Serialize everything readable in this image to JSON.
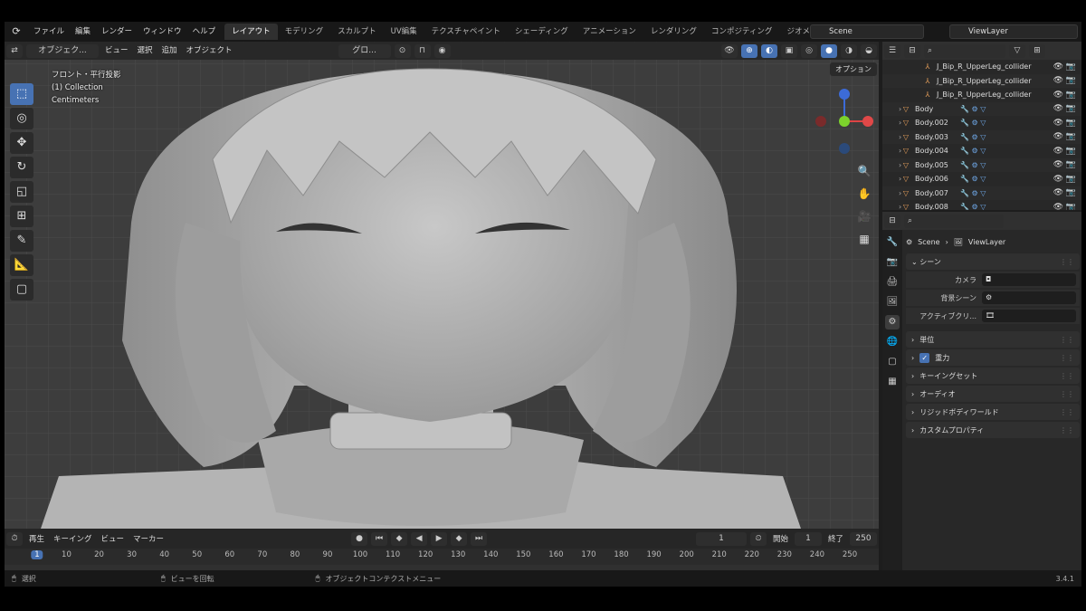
{
  "topbar": {
    "menus": [
      "ファイル",
      "編集",
      "レンダー",
      "ウィンドウ",
      "ヘルプ"
    ],
    "workspace_tabs": [
      "レイアウト",
      "モデリング",
      "スカルプト",
      "UV編集",
      "テクスチャペイント",
      "シェーディング",
      "アニメーション",
      "レンダリング",
      "コンポジティング",
      "ジオメトリ"
    ],
    "active_tab": "レイアウト",
    "scene": "Scene",
    "view_layer": "ViewLayer"
  },
  "viewport": {
    "mode": "オブジェク...",
    "menu": [
      "ビュー",
      "選択",
      "追加",
      "オブジェクト"
    ],
    "transform": "グロ...",
    "options": "オプション",
    "info_lines": [
      "フロント・平行投影",
      "(1) Collection",
      "Centimeters"
    ]
  },
  "timeline": {
    "menu": [
      "再生",
      "キーイング",
      "ビュー",
      "マーカー"
    ],
    "current_frame": "1",
    "start_label": "開始",
    "start": "1",
    "end_label": "終了",
    "end": "250",
    "ruler": [
      "1",
      "10",
      "20",
      "30",
      "40",
      "50",
      "60",
      "70",
      "80",
      "90",
      "100",
      "110",
      "120",
      "130",
      "140",
      "150",
      "160",
      "170",
      "180",
      "190",
      "200",
      "210",
      "220",
      "230",
      "240",
      "250"
    ]
  },
  "status": {
    "select": "選択",
    "rotate": "ビューを回転",
    "context": "オブジェクトコンテクストメニュー",
    "version": "3.4.1"
  },
  "outliner": {
    "rows": [
      {
        "label": "J_Bip_R_UpperLeg_collider",
        "type": "bone"
      },
      {
        "label": "J_Bip_R_UpperLeg_collider",
        "type": "bone"
      },
      {
        "label": "J_Bip_R_UpperLeg_collider",
        "type": "bone"
      },
      {
        "label": "Body",
        "type": "mesh"
      },
      {
        "label": "Body.002",
        "type": "mesh"
      },
      {
        "label": "Body.003",
        "type": "mesh"
      },
      {
        "label": "Body.004",
        "type": "mesh"
      },
      {
        "label": "Body.005",
        "type": "mesh"
      },
      {
        "label": "Body.006",
        "type": "mesh"
      },
      {
        "label": "Body.007",
        "type": "mesh"
      },
      {
        "label": "Body.008",
        "type": "mesh"
      }
    ]
  },
  "properties": {
    "breadcrumb_scene": "Scene",
    "breadcrumb_layer": "ViewLayer",
    "section_scene": "シーン",
    "camera_label": "カメラ",
    "bg_scene_label": "背景シーン",
    "active_clip_label": "アクティブクリ...",
    "sections": [
      "単位",
      "重力",
      "キーイングセット",
      "オーディオ",
      "リジッドボディワールド",
      "カスタムプロパティ"
    ],
    "gravity_checked": true
  }
}
